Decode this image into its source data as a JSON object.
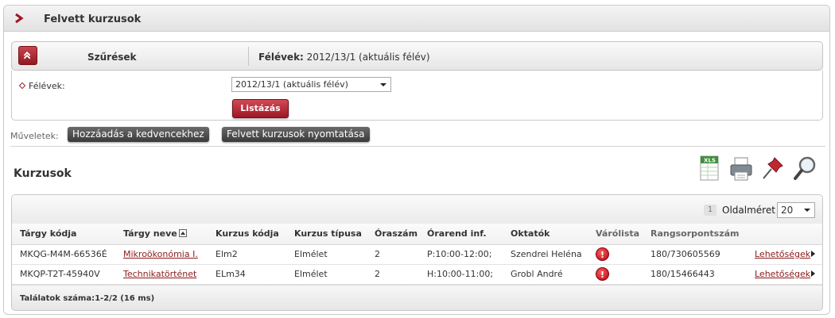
{
  "window": {
    "title": "Felvett kurzusok"
  },
  "filters": {
    "toggle_label": "Szűrések",
    "semester_prefix": "Félévek:",
    "semester_value": "2012/13/1 (aktuális félév)",
    "field_label": "Félévek:",
    "select_value": "2012/13/1 (aktuális félév)",
    "list_button": "Listázás"
  },
  "operations": {
    "label": "Műveletek:",
    "add_favorites": "Hozzáadás a kedvencekhez",
    "print_courses": "Felvett kurzusok nyomtatása"
  },
  "section": {
    "title": "Kurzusok",
    "icons": [
      "excel-export-icon",
      "print-icon",
      "pin-icon",
      "search-icon"
    ],
    "xls_text": "XLS"
  },
  "pager": {
    "page": "1",
    "size_label": "Oldalméret",
    "size_value": "20"
  },
  "table": {
    "headers": [
      "Tárgy kódja",
      "Tárgy neve",
      "Kurzus kódja",
      "Kurzus típusa",
      "Óraszám",
      "Órarend inf.",
      "Oktatók",
      "Várólista",
      "Rangsorpontszám",
      ""
    ],
    "rows": [
      [
        "MKQG-M4M-66536É",
        "Mikroökonómia I.",
        "Elm2",
        "Elmélet",
        "2",
        "P:10:00-12:00;",
        "Szendrei Heléna",
        "!",
        "180/730605569",
        "Lehetőségek"
      ],
      [
        "MKQP-T2T-45940V",
        "Technikatörténet",
        "ELm34",
        "Elmélet",
        "2",
        "H:10:00-11:00;",
        "Grobl André",
        "!",
        "180/15466443",
        "Lehetőségek"
      ]
    ]
  },
  "footer": {
    "results": "Találatok száma:1-2/2 (16 ms)"
  },
  "colors": {
    "accent": "#9e1624",
    "link": "#8b1a1a",
    "warning": "#c00010"
  }
}
